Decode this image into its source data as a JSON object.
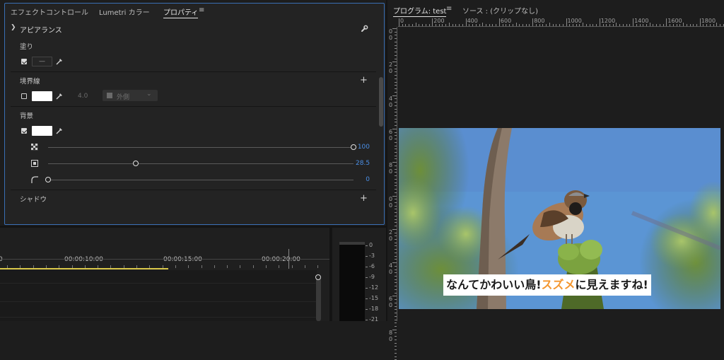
{
  "tabs": {
    "effect_controls": "エフェクトコントロール",
    "lumetri": "Lumetri カラー",
    "properties": "プロパティ"
  },
  "appearance": {
    "title": "アピアランス",
    "fill": {
      "label": "塗り",
      "checked": true,
      "swatch_text": "—"
    },
    "stroke": {
      "label": "境界線",
      "checked": false,
      "width": "4.0",
      "position": "外側"
    },
    "background": {
      "label": "背景",
      "checked": true,
      "opacity": {
        "value_label": "100",
        "fraction": 1.0
      },
      "size": {
        "value_label": "28.5",
        "fraction": 0.285
      },
      "corner": {
        "value_label": "0",
        "fraction": 0.0
      }
    },
    "shadow": {
      "label": "シャドウ"
    }
  },
  "program_monitor": {
    "title": "プログラム: test",
    "source": "ソース : (クリップなし)",
    "ruler_labels": [
      "0",
      "200",
      "400",
      "600",
      "800",
      "1000",
      "1200",
      "1400",
      "1600",
      "1800"
    ],
    "vruler_labels": [
      "0",
      "2",
      "4",
      "6",
      "8",
      "0",
      "2",
      "4",
      "6",
      "8"
    ],
    "caption": {
      "part1": "なんてかわいい鳥!",
      "highlight": "スズメ",
      "part2": "に見えますね!"
    }
  },
  "timeline": {
    "timecodes": [
      "0",
      "00:00:10:00",
      "00:00:15:00",
      "00:00:20:00"
    ],
    "playhead_fraction": 0.5
  },
  "meter": {
    "scale": [
      "0",
      "-3",
      "-6",
      "-9",
      "-12",
      "-15",
      "-18",
      "-21"
    ]
  },
  "colors": {
    "accent": "#3a6fb5",
    "value_blue": "#4b8fe6",
    "caption_orange": "#f4962e",
    "work_area": "#d9c84a",
    "sky": "#5a93d2"
  }
}
